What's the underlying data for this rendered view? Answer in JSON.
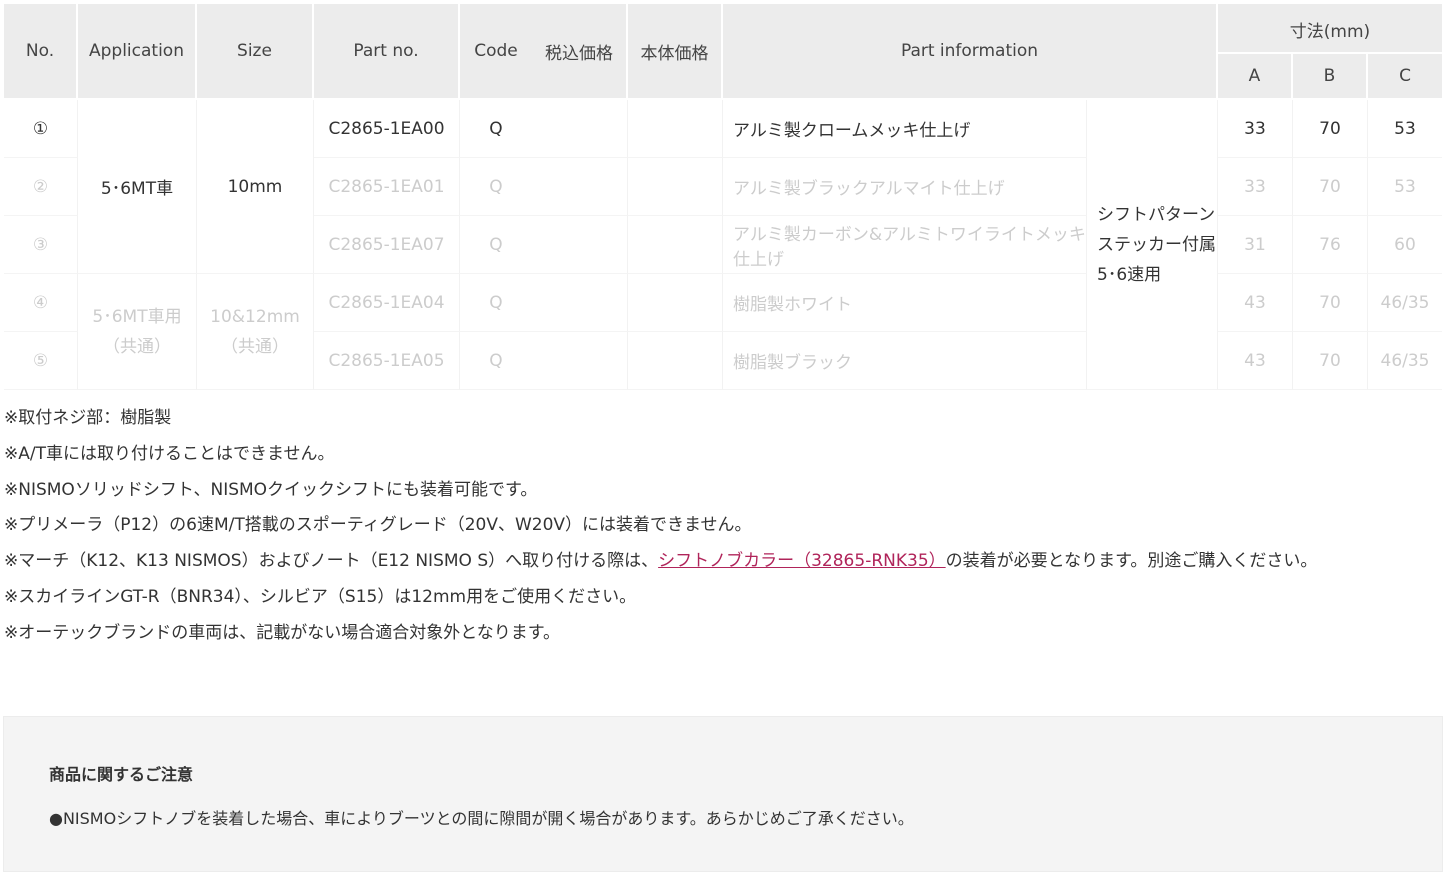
{
  "table": {
    "headers": {
      "no": "No.",
      "application": "Application",
      "size": "Size",
      "part_no": "Part no.",
      "code": "Code",
      "price_incl_tax": "税込価格",
      "price_base": "本体価格",
      "part_info": "Part information",
      "dimensions": "寸法(mm)",
      "dim_a": "A",
      "dim_b": "B",
      "dim_c": "C"
    },
    "rows": [
      {
        "no": "①",
        "part_no": "C2865-1EA00",
        "code": "Q",
        "info": "アルミ製クロームメッキ仕上げ",
        "a": "33",
        "b": "70",
        "c": "53"
      },
      {
        "no": "②",
        "part_no": "C2865-1EA01",
        "code": "Q",
        "info": "アルミ製ブラックアルマイト仕上げ",
        "a": "33",
        "b": "70",
        "c": "53"
      },
      {
        "no": "③",
        "part_no": "C2865-1EA07",
        "code": "Q",
        "info": "アルミ製カーボン&アルミトワイライトメッキ仕上げ",
        "a": "31",
        "b": "76",
        "c": "60"
      },
      {
        "no": "④",
        "part_no": "C2865-1EA04",
        "code": "Q",
        "info": "樹脂製ホワイト",
        "a": "43",
        "b": "70",
        "c": "46/35"
      },
      {
        "no": "⑤",
        "part_no": "C2865-1EA05",
        "code": "Q",
        "info": "樹脂製ブラック",
        "a": "43",
        "b": "70",
        "c": "46/35"
      }
    ],
    "group1": {
      "application": "5･6MT車",
      "size": "10mm"
    },
    "group2": {
      "application_line1": "5･6MT車用",
      "application_line2": "（共通）",
      "size_line1": "10&12mm",
      "size_line2": "（共通）"
    },
    "extra_info": {
      "line1": "シフトパターン",
      "line2": "ステッカー付属",
      "line3": "5･6速用"
    }
  },
  "notes": {
    "n1": "※取付ネジ部：樹脂製",
    "n2": "※A/T車には取り付けることはできません。",
    "n3": "※NISMOソリッドシフト、NISMOクイックシフトにも装着可能です。",
    "n4": "※プリメーラ（P12）の6速M/T搭載のスポーティグレード（20V、W20V）には装着できません。",
    "n5_before": "※マーチ（K12、K13 NISMOS）およびノート（E12 NISMO S）へ取り付ける際は、",
    "n5_link": "シフトノブカラー（32865-RNK35）",
    "n5_after": "の装着が必要となります。別途ご購入ください。",
    "n6": "※スカイラインGT-R（BNR34）、シルビア（S15）は12mm用をご使用ください。",
    "n7": "※オーテックブランドの車両は、記載がない場合適合対象外となります。"
  },
  "caution": {
    "title": "商品に関するご注意",
    "body": "●NISMOシフトノブを装着した場合、車によりブーツとの間に隙間が開く場合があります。あらかじめご了承ください。"
  },
  "colors": {
    "header_bg": "#ececec",
    "link": "#b0245a",
    "dim_text": "#cccccc",
    "caution_bg": "#f4f4f4"
  }
}
